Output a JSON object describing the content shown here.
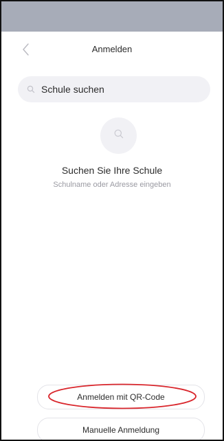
{
  "header": {
    "title": "Anmelden",
    "back_icon": "chevron-left-icon"
  },
  "search": {
    "placeholder": "Schule suchen",
    "icon": "search-icon"
  },
  "empty_state": {
    "icon": "search-icon",
    "title": "Suchen Sie Ihre Schule",
    "subtitle": "Schulname oder Adresse eingeben"
  },
  "actions": {
    "qr_label": "Anmelden mit QR-Code",
    "manual_label": "Manuelle Anmeldung"
  },
  "colors": {
    "status_bar": "#a7acb8",
    "annotation": "#d9262c",
    "field_bg": "#f1f1f5"
  }
}
